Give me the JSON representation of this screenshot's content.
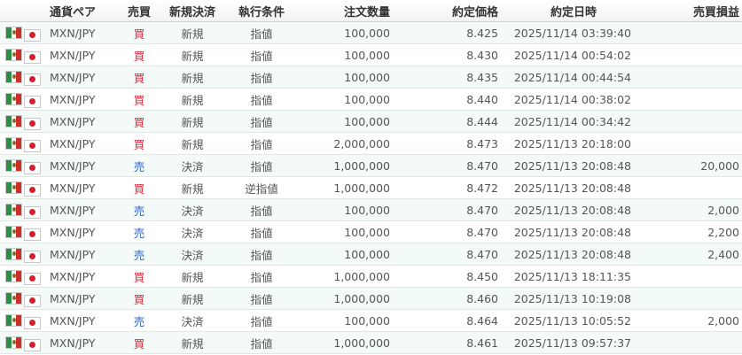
{
  "headers": {
    "pair": "通貨ペア",
    "side": "売買",
    "type": "新規決済",
    "condition": "執行条件",
    "quantity": "注文数量",
    "price": "約定価格",
    "datetime": "約定日時",
    "pl": "売買損益"
  },
  "colors": {
    "buy": "#d9263a",
    "sell": "#2c63c8",
    "row_alt": "#f4faf7"
  },
  "icons": {
    "base": "mexico-flag-icon",
    "quote": "japan-flag-icon"
  },
  "rows": [
    {
      "pair": "MXN/JPY",
      "side": "買",
      "side_kind": "buy",
      "type": "新規",
      "condition": "指値",
      "quantity": "100,000",
      "price": "8.425",
      "datetime": "2025/11/14 03:39:40",
      "pl": ""
    },
    {
      "pair": "MXN/JPY",
      "side": "買",
      "side_kind": "buy",
      "type": "新規",
      "condition": "指値",
      "quantity": "100,000",
      "price": "8.430",
      "datetime": "2025/11/14 00:54:02",
      "pl": ""
    },
    {
      "pair": "MXN/JPY",
      "side": "買",
      "side_kind": "buy",
      "type": "新規",
      "condition": "指値",
      "quantity": "100,000",
      "price": "8.435",
      "datetime": "2025/11/14 00:44:54",
      "pl": ""
    },
    {
      "pair": "MXN/JPY",
      "side": "買",
      "side_kind": "buy",
      "type": "新規",
      "condition": "指値",
      "quantity": "100,000",
      "price": "8.440",
      "datetime": "2025/11/14 00:38:02",
      "pl": ""
    },
    {
      "pair": "MXN/JPY",
      "side": "買",
      "side_kind": "buy",
      "type": "新規",
      "condition": "指値",
      "quantity": "100,000",
      "price": "8.444",
      "datetime": "2025/11/14 00:34:42",
      "pl": ""
    },
    {
      "pair": "MXN/JPY",
      "side": "買",
      "side_kind": "buy",
      "type": "新規",
      "condition": "指値",
      "quantity": "2,000,000",
      "price": "8.473",
      "datetime": "2025/11/13 20:18:00",
      "pl": ""
    },
    {
      "pair": "MXN/JPY",
      "side": "売",
      "side_kind": "sell",
      "type": "決済",
      "condition": "指値",
      "quantity": "1,000,000",
      "price": "8.470",
      "datetime": "2025/11/13 20:08:48",
      "pl": "20,000"
    },
    {
      "pair": "MXN/JPY",
      "side": "買",
      "side_kind": "buy",
      "type": "新規",
      "condition": "逆指値",
      "quantity": "1,000,000",
      "price": "8.472",
      "datetime": "2025/11/13 20:08:48",
      "pl": ""
    },
    {
      "pair": "MXN/JPY",
      "side": "売",
      "side_kind": "sell",
      "type": "決済",
      "condition": "指値",
      "quantity": "100,000",
      "price": "8.470",
      "datetime": "2025/11/13 20:08:48",
      "pl": "2,000"
    },
    {
      "pair": "MXN/JPY",
      "side": "売",
      "side_kind": "sell",
      "type": "決済",
      "condition": "指値",
      "quantity": "100,000",
      "price": "8.470",
      "datetime": "2025/11/13 20:08:48",
      "pl": "2,200"
    },
    {
      "pair": "MXN/JPY",
      "side": "売",
      "side_kind": "sell",
      "type": "決済",
      "condition": "指値",
      "quantity": "100,000",
      "price": "8.470",
      "datetime": "2025/11/13 20:08:48",
      "pl": "2,400"
    },
    {
      "pair": "MXN/JPY",
      "side": "買",
      "side_kind": "buy",
      "type": "新規",
      "condition": "指値",
      "quantity": "1,000,000",
      "price": "8.450",
      "datetime": "2025/11/13 18:11:35",
      "pl": ""
    },
    {
      "pair": "MXN/JPY",
      "side": "買",
      "side_kind": "buy",
      "type": "新規",
      "condition": "指値",
      "quantity": "1,000,000",
      "price": "8.460",
      "datetime": "2025/11/13 10:19:08",
      "pl": ""
    },
    {
      "pair": "MXN/JPY",
      "side": "売",
      "side_kind": "sell",
      "type": "決済",
      "condition": "指値",
      "quantity": "100,000",
      "price": "8.464",
      "datetime": "2025/11/13 10:05:52",
      "pl": "2,000"
    },
    {
      "pair": "MXN/JPY",
      "side": "買",
      "side_kind": "buy",
      "type": "新規",
      "condition": "指値",
      "quantity": "1,000,000",
      "price": "8.461",
      "datetime": "2025/11/13 09:57:37",
      "pl": ""
    }
  ]
}
